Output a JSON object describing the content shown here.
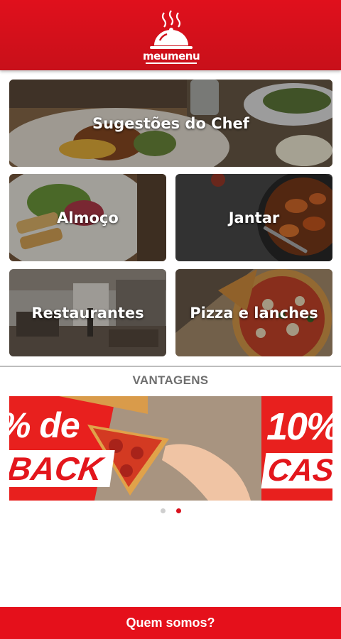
{
  "header": {
    "logo_text_part1": "meu",
    "logo_text_part2": "menu",
    "brand_color": "#e0101c"
  },
  "categories": [
    {
      "label": "Sugestões do Chef",
      "icon": "plate-steak-photo"
    },
    {
      "label": "Almoço",
      "icon": "salad-grilled-photo"
    },
    {
      "label": "Jantar",
      "icon": "shrimp-pan-photo"
    },
    {
      "label": "Restaurantes",
      "icon": "restaurant-interior-photo"
    },
    {
      "label": "Pizza e lanches",
      "icon": "pizza-photo"
    }
  ],
  "section": {
    "title": "VANTAGENS"
  },
  "banner": {
    "left_line1": "% de",
    "left_line2": "BACK",
    "right_line1": "10%",
    "right_line2": "CASH",
    "accent": "#e3161c"
  },
  "carousel": {
    "total_pages": 2,
    "active_page": 2
  },
  "footer": {
    "label": "Quem somos?"
  }
}
